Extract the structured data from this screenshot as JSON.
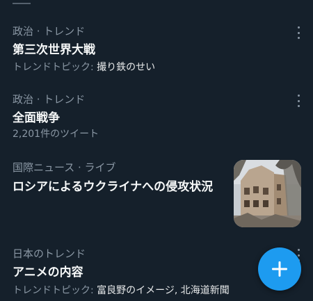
{
  "trends": [
    {
      "category": "政治 · トレンド",
      "title": "第三次世界大戦",
      "meta_prefix": "トレンドトピック: ",
      "meta_topic": "撮り鉄のせい"
    },
    {
      "category": "政治 · トレンド",
      "title": "全面戦争",
      "meta_text": "2,201件のツイート"
    },
    {
      "category": "国際ニュース · ライブ",
      "title": "ロシアによるウクライナへの侵攻状況",
      "thumbnail_icon": "war-damaged-building-photo"
    },
    {
      "category": "日本のトレンド",
      "title": "アニメの内容",
      "meta_prefix": "トレンドトピック: ",
      "meta_topic": "富良野のイメージ, 北海道新聞"
    }
  ],
  "icons": {
    "more": "more-vertical-icon",
    "compose": "plus-icon"
  },
  "colors": {
    "background": "#15202b",
    "accent": "#1d9bf0",
    "secondary_text": "#8b98a5",
    "primary_text": "#e7e9ea"
  }
}
